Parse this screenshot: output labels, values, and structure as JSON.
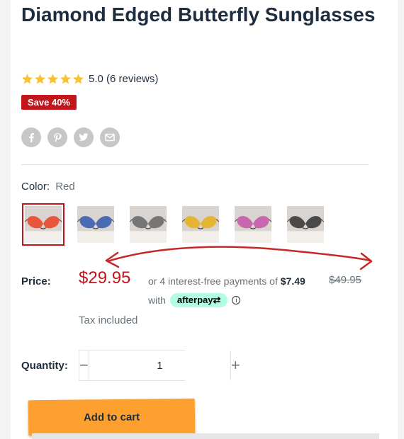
{
  "product": {
    "title": "Diamond Edged Butterfly Sunglasses",
    "rating_value": 5.0,
    "rating_text": "5.0 (6 reviews)",
    "save_badge": "Save 40%"
  },
  "share": [
    {
      "icon": "facebook-icon",
      "glyph": "f"
    },
    {
      "icon": "pinterest-icon",
      "glyph": "P"
    },
    {
      "icon": "twitter-icon",
      "glyph": "t"
    },
    {
      "icon": "email-icon",
      "glyph": "✉"
    }
  ],
  "color": {
    "label": "Color:",
    "value": "Red",
    "swatches": [
      {
        "name": "Red",
        "lens": "#e8472a",
        "selected": true
      },
      {
        "name": "Blue",
        "lens": "#3a5fb0",
        "selected": false
      },
      {
        "name": "Gray",
        "lens": "#6b6b6b",
        "selected": false
      },
      {
        "name": "Yellow",
        "lens": "#e7b021",
        "selected": false
      },
      {
        "name": "Pink",
        "lens": "#c55ba8",
        "selected": false
      },
      {
        "name": "Black",
        "lens": "#3a3a3a",
        "selected": false
      }
    ]
  },
  "price": {
    "label": "Price:",
    "current": "$29.95",
    "installments_prefix": "or 4 interest-free payments of",
    "installment_amount": "$7.49",
    "with_text": "with",
    "afterpay_label": "afterpay⇄",
    "info_glyph": "i",
    "compare_at": "$49.95",
    "tax_note": "Tax included"
  },
  "quantity": {
    "label": "Quantity:",
    "minus": "−",
    "value": "1",
    "plus": "+"
  },
  "cart": {
    "add_label": "Add to cart"
  },
  "colors": {
    "accent_red": "#c4151c",
    "star_yellow": "#fbc02d",
    "button_orange": "#fda02f",
    "afterpay_mint": "#b2fce4",
    "annotation_red": "#c62828"
  }
}
